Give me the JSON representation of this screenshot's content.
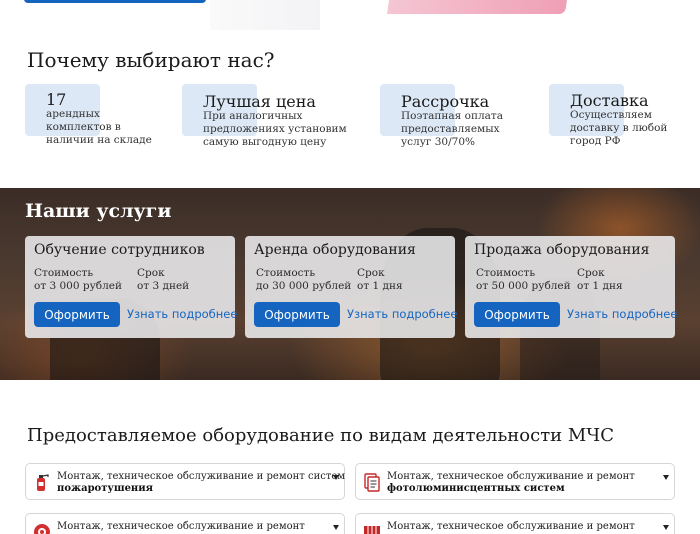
{
  "why": {
    "title": "Почему выбирают нас?",
    "features": [
      {
        "head": "17",
        "desc": [
          "арендных",
          "комплектов в",
          "наличии на складе"
        ]
      },
      {
        "head": "Лучшая цена",
        "desc": [
          "При аналогичных",
          "предложениях установим",
          "самую выгодную цену"
        ]
      },
      {
        "head": "Рассрочка",
        "desc": [
          "Поэтапная оплата",
          "предоставляемых",
          "услуг 30/70%"
        ]
      },
      {
        "head": "Доставка",
        "desc": [
          "Осуществляем",
          "доставку в любой",
          "город РФ"
        ]
      }
    ]
  },
  "services": {
    "title": "Наши услуги",
    "cards": [
      {
        "title": "Обучение сотрудников",
        "cost_label": "Стоимость",
        "cost": "от 3 000 рублей",
        "term_label": "Срок",
        "term": "от 3 дней",
        "order": "Оформить",
        "more": "Узнать подробнее"
      },
      {
        "title": "Аренда оборудования",
        "cost_label": "Стоимость",
        "cost": "до 30 000 рублей",
        "term_label": "Срок",
        "term": "от 1 дня",
        "order": "Оформить",
        "more": "Узнать подробнее"
      },
      {
        "title": "Продажа оборудования",
        "cost_label": "Стоимость",
        "cost": "от 50 000 рублей",
        "term_label": "Срок",
        "term": "от 1 дня",
        "order": "Оформить",
        "more": "Узнать подробнее"
      }
    ]
  },
  "equipment": {
    "title": "Предоставляемое оборудование по видам деятельности МЧС",
    "items": [
      {
        "line1": "Монтаж, техническое обслуживание и ремонт систем",
        "line2": "пожаротушения",
        "icon": "fire-extinguisher-icon"
      },
      {
        "line1": "Монтаж, техническое обслуживание и ремонт",
        "line2": "фотолюминисцентных систем",
        "icon": "documents-icon"
      },
      {
        "line1": "Монтаж, техническое обслуживание и ремонт",
        "line2": "",
        "icon": "alarm-icon"
      },
      {
        "line1": "Монтаж, техническое обслуживание и ремонт",
        "line2": "",
        "icon": "radiator-icon"
      }
    ]
  },
  "colors": {
    "accent": "#1565c0",
    "feature_pad": "#dce8f5"
  }
}
